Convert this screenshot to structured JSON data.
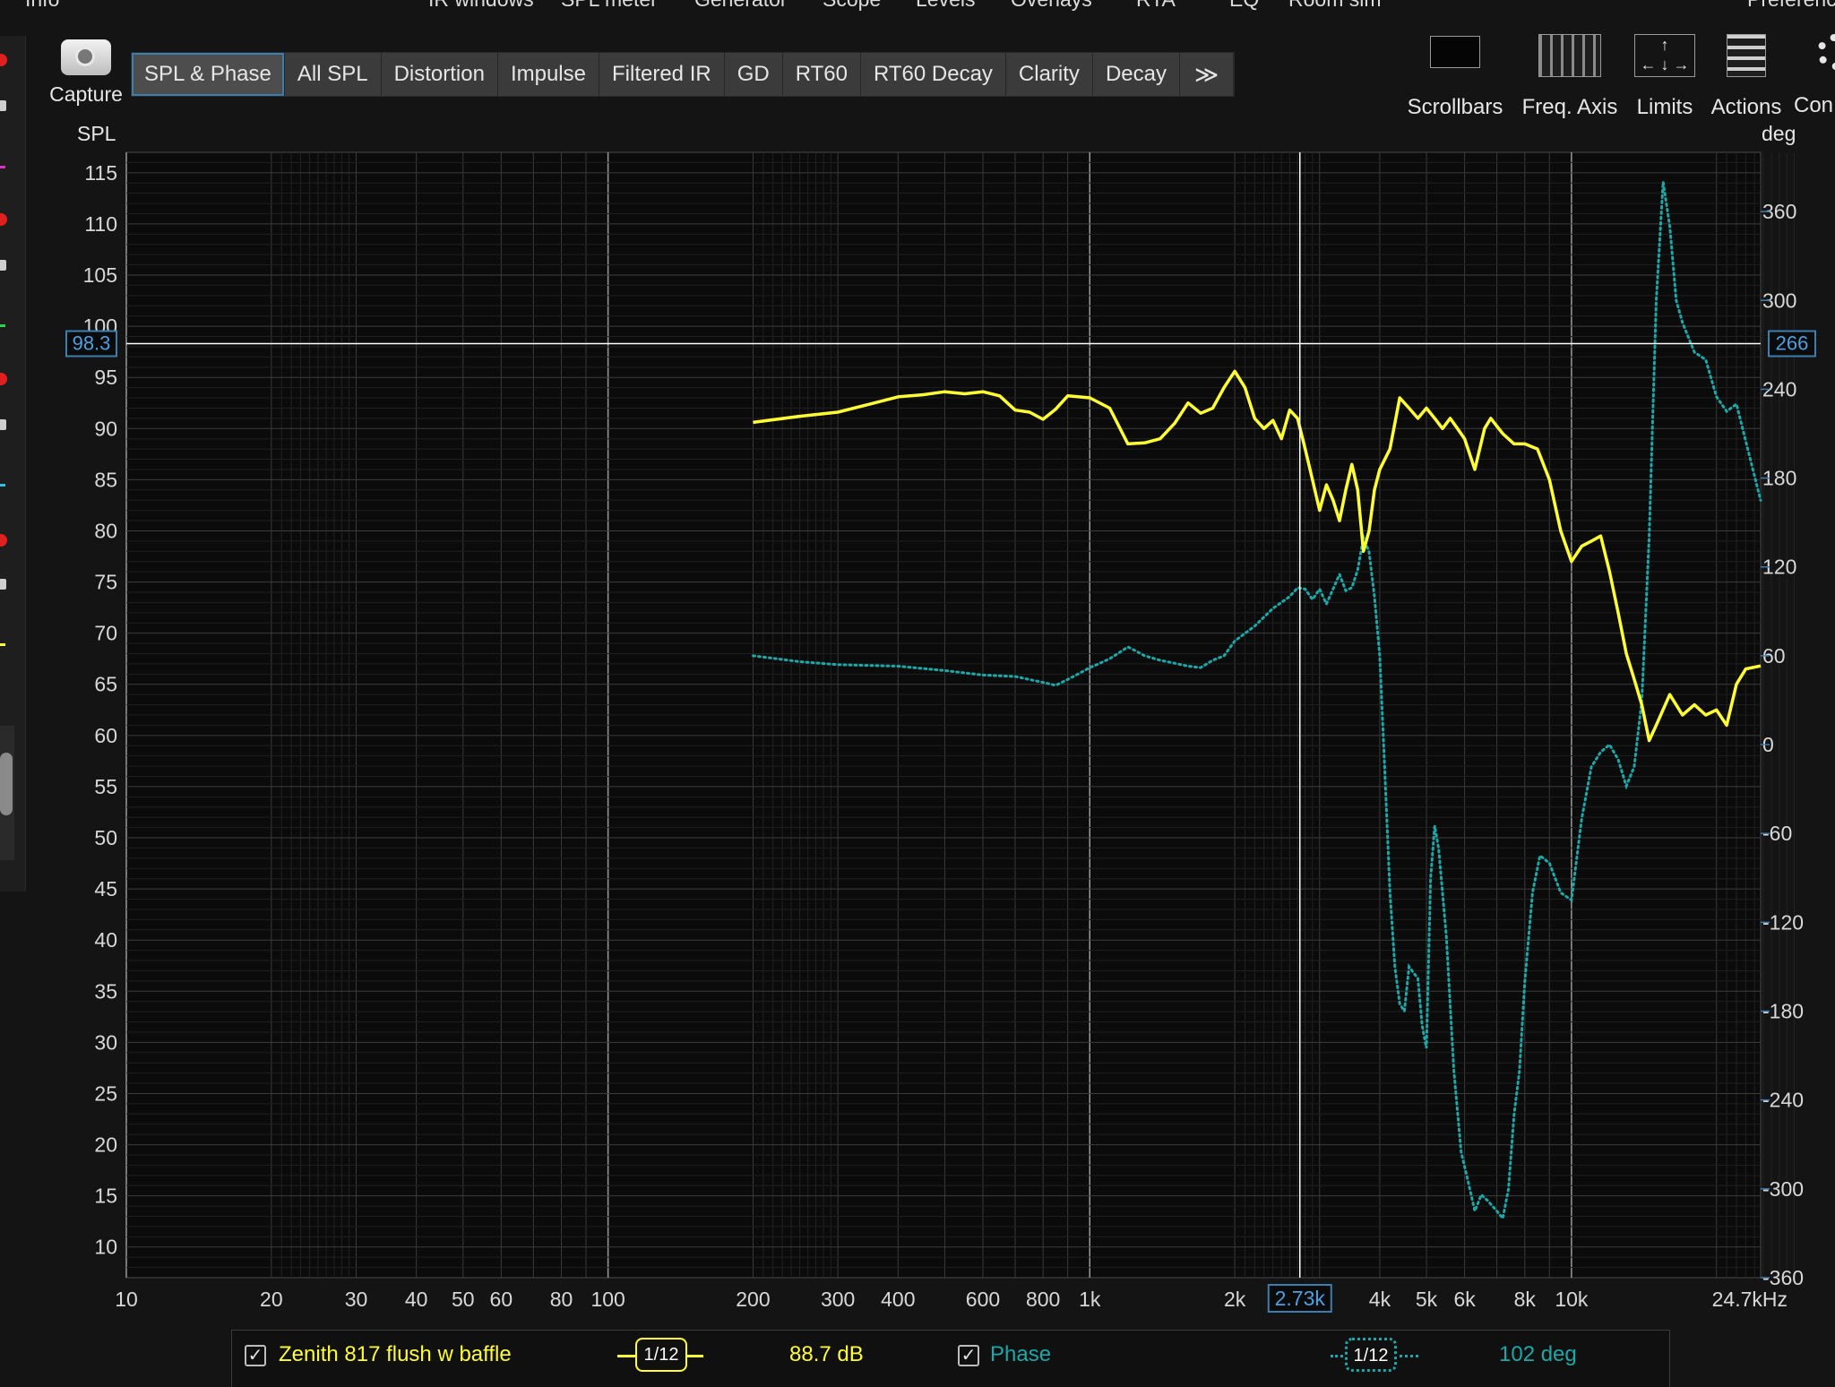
{
  "top_menu": [
    "Info",
    "IR windows",
    "SPL meter",
    "Generator",
    "Scope",
    "Levels",
    "Overlays",
    "RTA",
    "EQ",
    "Room sim",
    "Preferences"
  ],
  "capture": {
    "label": "Capture"
  },
  "tabs": [
    "SPL & Phase",
    "All SPL",
    "Distortion",
    "Impulse",
    "Filtered IR",
    "GD",
    "RT60",
    "RT60 Decay",
    "Clarity",
    "Decay",
    "≫"
  ],
  "toolbar": {
    "scrollbars": "Scrollbars",
    "freq_axis": "Freq. Axis",
    "limits": "Limits",
    "actions": "Actions",
    "controls": "Con"
  },
  "cursor": {
    "spl_readout": "98.3",
    "phase_readout": "266",
    "freq_readout": "2.73k"
  },
  "legend": {
    "spl_name": "Zenith 817 flush w baffle",
    "spl_smoothing": "1/12",
    "spl_value": "88.7 dB",
    "phase_name": "Phase",
    "phase_smoothing": "1/12",
    "phase_value": "102 deg",
    "check_mark": "✓"
  },
  "colors": {
    "spl": "#ffff33",
    "phase": "#1aa8a8",
    "cursor": "#ffffff",
    "highlight": "#3a7fb0"
  },
  "chart_data": {
    "type": "line",
    "x_scale": "log",
    "xlim": [
      10,
      24700
    ],
    "ylim": [
      7,
      117
    ],
    "y2lim": [
      -360,
      400
    ],
    "ylabel": "SPL",
    "y2label": "deg",
    "xlabel": "kHz",
    "grid": true,
    "x_ticks": [
      {
        "v": 10,
        "t": "10"
      },
      {
        "v": 20,
        "t": "20"
      },
      {
        "v": 30,
        "t": "30"
      },
      {
        "v": 40,
        "t": "40"
      },
      {
        "v": 50,
        "t": "50"
      },
      {
        "v": 60,
        "t": "60"
      },
      {
        "v": 80,
        "t": "80"
      },
      {
        "v": 100,
        "t": "100"
      },
      {
        "v": 200,
        "t": "200"
      },
      {
        "v": 300,
        "t": "300"
      },
      {
        "v": 400,
        "t": "400"
      },
      {
        "v": 600,
        "t": "600"
      },
      {
        "v": 800,
        "t": "800"
      },
      {
        "v": 1000,
        "t": "1k"
      },
      {
        "v": 2000,
        "t": "2k"
      },
      {
        "v": 4000,
        "t": "4k"
      },
      {
        "v": 5000,
        "t": "5k"
      },
      {
        "v": 6000,
        "t": "6k"
      },
      {
        "v": 8000,
        "t": "8k"
      },
      {
        "v": 10000,
        "t": "10k"
      },
      {
        "v": 24700,
        "t": "24.7kHz"
      }
    ],
    "y_ticks": [
      10,
      15,
      20,
      25,
      30,
      35,
      40,
      45,
      50,
      55,
      60,
      65,
      70,
      75,
      80,
      85,
      90,
      95,
      100,
      105,
      110,
      115
    ],
    "y2_ticks": [
      -360,
      -300,
      -240,
      -180,
      -120,
      -60,
      0,
      60,
      120,
      180,
      240,
      300,
      360
    ],
    "cursor_point": {
      "x": 2730,
      "y": 98.3,
      "y2": 266
    },
    "series": [
      {
        "name": "Zenith 817 flush w baffle",
        "axis": "left",
        "points": [
          [
            200,
            90.6
          ],
          [
            250,
            91.2
          ],
          [
            300,
            91.6
          ],
          [
            350,
            92.4
          ],
          [
            400,
            93.1
          ],
          [
            450,
            93.3
          ],
          [
            500,
            93.6
          ],
          [
            550,
            93.4
          ],
          [
            600,
            93.6
          ],
          [
            650,
            93.2
          ],
          [
            700,
            91.8
          ],
          [
            750,
            91.6
          ],
          [
            800,
            90.9
          ],
          [
            850,
            91.9
          ],
          [
            900,
            93.2
          ],
          [
            1000,
            93.0
          ],
          [
            1100,
            92.0
          ],
          [
            1200,
            88.5
          ],
          [
            1300,
            88.6
          ],
          [
            1400,
            89.0
          ],
          [
            1500,
            90.5
          ],
          [
            1600,
            92.5
          ],
          [
            1700,
            91.5
          ],
          [
            1800,
            92.0
          ],
          [
            1900,
            94.0
          ],
          [
            2000,
            95.6
          ],
          [
            2100,
            94.0
          ],
          [
            2200,
            91.0
          ],
          [
            2300,
            90.0
          ],
          [
            2400,
            90.8
          ],
          [
            2500,
            89.0
          ],
          [
            2600,
            91.8
          ],
          [
            2700,
            91.0
          ],
          [
            2800,
            88.0
          ],
          [
            2900,
            85.0
          ],
          [
            3000,
            82.0
          ],
          [
            3100,
            84.5
          ],
          [
            3200,
            83.0
          ],
          [
            3300,
            81.0
          ],
          [
            3400,
            84.0
          ],
          [
            3500,
            86.5
          ],
          [
            3600,
            84.0
          ],
          [
            3700,
            78.0
          ],
          [
            3800,
            80.0
          ],
          [
            3900,
            84.0
          ],
          [
            4000,
            86.0
          ],
          [
            4200,
            88.0
          ],
          [
            4400,
            93.0
          ],
          [
            4600,
            92.0
          ],
          [
            4800,
            91.0
          ],
          [
            5000,
            92.0
          ],
          [
            5200,
            91.0
          ],
          [
            5400,
            90.0
          ],
          [
            5600,
            91.0
          ],
          [
            5800,
            90.0
          ],
          [
            6000,
            89.0
          ],
          [
            6300,
            86.0
          ],
          [
            6600,
            90.0
          ],
          [
            6800,
            91.0
          ],
          [
            7200,
            89.5
          ],
          [
            7600,
            88.5
          ],
          [
            8000,
            88.5
          ],
          [
            8500,
            88.0
          ],
          [
            9000,
            85.0
          ],
          [
            9500,
            80.0
          ],
          [
            10000,
            77.0
          ],
          [
            10500,
            78.5
          ],
          [
            11000,
            79.0
          ],
          [
            11500,
            79.5
          ],
          [
            12000,
            76.0
          ],
          [
            12500,
            72.0
          ],
          [
            13000,
            68.0
          ],
          [
            13500,
            65.5
          ],
          [
            14000,
            63.0
          ],
          [
            14500,
            59.5
          ],
          [
            15000,
            61.0
          ],
          [
            16000,
            64.0
          ],
          [
            17000,
            62.0
          ],
          [
            18000,
            63.0
          ],
          [
            19000,
            62.0
          ],
          [
            20000,
            62.5
          ],
          [
            21000,
            61.0
          ],
          [
            22000,
            65.0
          ],
          [
            23000,
            66.5
          ],
          [
            24700,
            66.8
          ]
        ]
      },
      {
        "name": "Phase",
        "axis": "right",
        "points": [
          [
            200,
            60
          ],
          [
            250,
            56
          ],
          [
            300,
            54
          ],
          [
            400,
            53
          ],
          [
            500,
            50
          ],
          [
            600,
            47
          ],
          [
            700,
            46
          ],
          [
            800,
            42
          ],
          [
            850,
            40
          ],
          [
            900,
            44
          ],
          [
            950,
            48
          ],
          [
            1000,
            52
          ],
          [
            1050,
            55
          ],
          [
            1100,
            58
          ],
          [
            1150,
            62
          ],
          [
            1200,
            66
          ],
          [
            1250,
            63
          ],
          [
            1300,
            60
          ],
          [
            1400,
            57
          ],
          [
            1500,
            55
          ],
          [
            1600,
            53
          ],
          [
            1700,
            52
          ],
          [
            1800,
            57
          ],
          [
            1900,
            60
          ],
          [
            2000,
            70
          ],
          [
            2200,
            80
          ],
          [
            2400,
            92
          ],
          [
            2600,
            100
          ],
          [
            2700,
            106
          ],
          [
            2800,
            105
          ],
          [
            2900,
            98
          ],
          [
            3000,
            105
          ],
          [
            3100,
            95
          ],
          [
            3200,
            105
          ],
          [
            3300,
            115
          ],
          [
            3400,
            104
          ],
          [
            3500,
            106
          ],
          [
            3600,
            118
          ],
          [
            3700,
            140
          ],
          [
            3800,
            130
          ],
          [
            3900,
            100
          ],
          [
            4000,
            60
          ],
          [
            4100,
            -20
          ],
          [
            4200,
            -100
          ],
          [
            4300,
            -150
          ],
          [
            4400,
            -175
          ],
          [
            4500,
            -180
          ],
          [
            4600,
            -150
          ],
          [
            4800,
            -158
          ],
          [
            4900,
            -190
          ],
          [
            5000,
            -205
          ],
          [
            5100,
            -90
          ],
          [
            5200,
            -55
          ],
          [
            5300,
            -70
          ],
          [
            5500,
            -130
          ],
          [
            5700,
            -220
          ],
          [
            5900,
            -275
          ],
          [
            6100,
            -295
          ],
          [
            6300,
            -315
          ],
          [
            6500,
            -304
          ],
          [
            6700,
            -308
          ],
          [
            7000,
            -315
          ],
          [
            7200,
            -320
          ],
          [
            7400,
            -300
          ],
          [
            7600,
            -250
          ],
          [
            7800,
            -220
          ],
          [
            8000,
            -160
          ],
          [
            8300,
            -100
          ],
          [
            8600,
            -75
          ],
          [
            9000,
            -80
          ],
          [
            9500,
            -100
          ],
          [
            10000,
            -105
          ],
          [
            10500,
            -50
          ],
          [
            11000,
            -15
          ],
          [
            11500,
            -5
          ],
          [
            12000,
            0
          ],
          [
            12500,
            -10
          ],
          [
            13000,
            -28
          ],
          [
            13500,
            -15
          ],
          [
            14000,
            30
          ],
          [
            14500,
            140
          ],
          [
            15000,
            300
          ],
          [
            15500,
            380
          ],
          [
            16000,
            350
          ],
          [
            16500,
            300
          ],
          [
            17000,
            285
          ],
          [
            18000,
            265
          ],
          [
            19000,
            260
          ],
          [
            20000,
            235
          ],
          [
            21000,
            225
          ],
          [
            22000,
            230
          ],
          [
            23000,
            205
          ],
          [
            24700,
            165
          ]
        ]
      }
    ]
  }
}
